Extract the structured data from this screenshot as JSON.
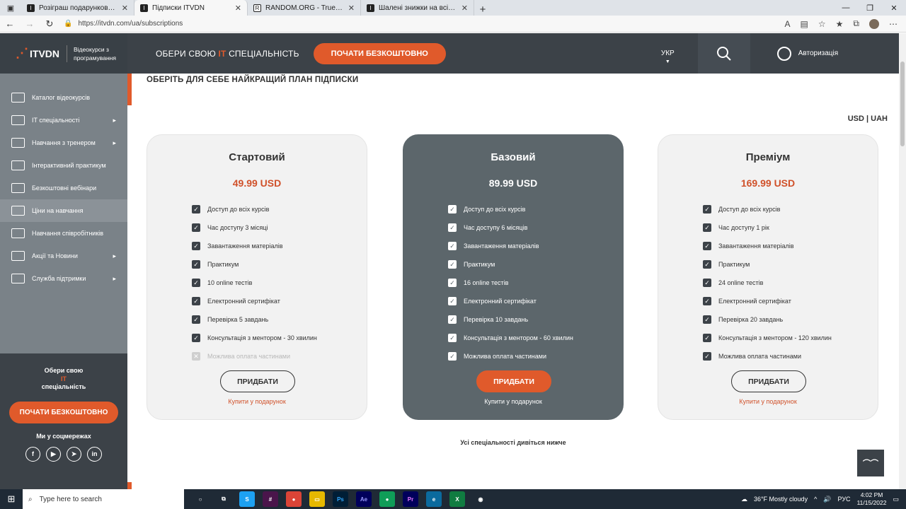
{
  "browser": {
    "tabs": [
      {
        "title": "Розіграш подарункових сертиф",
        "icon": "itvdn-icon",
        "active": false
      },
      {
        "title": "Підписки ITVDN",
        "icon": "itvdn-icon",
        "active": true
      },
      {
        "title": "RANDOM.ORG - True Random N",
        "icon": "random-org-icon",
        "active": false
      },
      {
        "title": "Шалені знижки на всі IT-спеціа",
        "icon": "itvdn-icon",
        "active": false
      }
    ],
    "url": "https://itvdn.com/ua/subscriptions"
  },
  "header": {
    "logo_text": "ITVDN",
    "logo_sub": "Відеокурси з програмування",
    "title_pre": "ОБЕРИ СВОЮ ",
    "title_it": "IT",
    "title_post": " СПЕЦІАЛЬНІСТЬ",
    "cta": "ПОЧАТИ БЕЗКОШТОВНО",
    "lang": "УКР",
    "auth": "Авторизація"
  },
  "sidebar": {
    "items": [
      {
        "label": "Каталог відеокурсів",
        "chevron": false,
        "active": false
      },
      {
        "label": "IT спеціальності",
        "chevron": true,
        "active": false
      },
      {
        "label": "Навчання з тренером",
        "chevron": true,
        "active": false
      },
      {
        "label": "Інтерактивний практикум",
        "chevron": false,
        "active": false
      },
      {
        "label": "Безкоштовні вебінари",
        "chevron": false,
        "active": false
      },
      {
        "label": "Ціни на навчання",
        "chevron": false,
        "active": true
      },
      {
        "label": "Навчання співробітників",
        "chevron": false,
        "active": false
      },
      {
        "label": "Акції та Новини",
        "chevron": true,
        "active": false
      },
      {
        "label": "Служба підтримки",
        "chevron": true,
        "active": false
      }
    ],
    "bottom_title_1": "Обери свою",
    "bottom_title_it": "IT",
    "bottom_title_2": "спеціальність",
    "bottom_cta": "ПОЧАТИ БЕЗКОШТОВНО",
    "social_title": "Ми у соцмережах",
    "social": [
      "f",
      "▶",
      "➤",
      "in"
    ]
  },
  "main": {
    "title": "ОБЕРІТЬ ДЛЯ СЕБЕ НАЙКРАЩИЙ ПЛАН ПІДПИСКИ",
    "currency_usd": "USD",
    "currency_sep": "|",
    "currency_uah": "UAH",
    "plans": [
      {
        "name": "Стартовий",
        "price": "49.99 USD",
        "features": [
          {
            "text": "Доступ до всіх курсів",
            "on": true
          },
          {
            "text": "Час доступу 3 місяці",
            "on": true
          },
          {
            "text": "Завантаження матеріалів",
            "on": true
          },
          {
            "text": "Практикум",
            "on": true
          },
          {
            "text": "10 online тестів",
            "on": true
          },
          {
            "text": "Електронний сертифікат",
            "on": true
          },
          {
            "text": "Перевірка 5 завдань",
            "on": true
          },
          {
            "text": "Консультація з ментором - 30 хвилин",
            "on": true
          },
          {
            "text": "Можлива оплата частинами",
            "on": false
          }
        ],
        "buy": "ПРИДБАТИ",
        "gift": "Купити у подарунок"
      },
      {
        "name": "Базовий",
        "price": "89.99 USD",
        "features": [
          {
            "text": "Доступ до всіх курсів",
            "on": true
          },
          {
            "text": "Час доступу 6 місяців",
            "on": true
          },
          {
            "text": "Завантаження матеріалів",
            "on": true
          },
          {
            "text": "Практикум",
            "on": true
          },
          {
            "text": "16 online тестів",
            "on": true
          },
          {
            "text": "Електронний сертифікат",
            "on": true
          },
          {
            "text": "Перевірка 10 завдань",
            "on": true
          },
          {
            "text": "Консультація з ментором - 60 хвилин",
            "on": true
          },
          {
            "text": "Можлива оплата частинами",
            "on": true
          }
        ],
        "buy": "ПРИДБАТИ",
        "gift": "Купити у подарунок"
      },
      {
        "name": "Преміум",
        "price": "169.99 USD",
        "features": [
          {
            "text": "Доступ до всіх курсів",
            "on": true
          },
          {
            "text": "Час доступу 1 рік",
            "on": true
          },
          {
            "text": "Завантаження матеріалів",
            "on": true
          },
          {
            "text": "Практикум",
            "on": true
          },
          {
            "text": "24 online тестів",
            "on": true
          },
          {
            "text": "Електронний сертифікат",
            "on": true
          },
          {
            "text": "Перевірка 20 завдань",
            "on": true
          },
          {
            "text": "Консультація з ментором - 120 хвилин",
            "on": true
          },
          {
            "text": "Можлива оплата частинами",
            "on": true
          }
        ],
        "buy": "ПРИДБАТИ",
        "gift": "Купити у подарунок"
      }
    ],
    "note": "Усі спеціальності дивіться нижче"
  },
  "taskbar": {
    "search_placeholder": "Type here to search",
    "weather": "36°F  Mostly cloudy",
    "lang": "РУС",
    "time": "4:02 PM",
    "date": "11/15/2022"
  },
  "colors": {
    "accent": "#e05a2b",
    "header": "#3c4248",
    "sidebar": "#7a8288",
    "featured_card": "#5c666b"
  }
}
